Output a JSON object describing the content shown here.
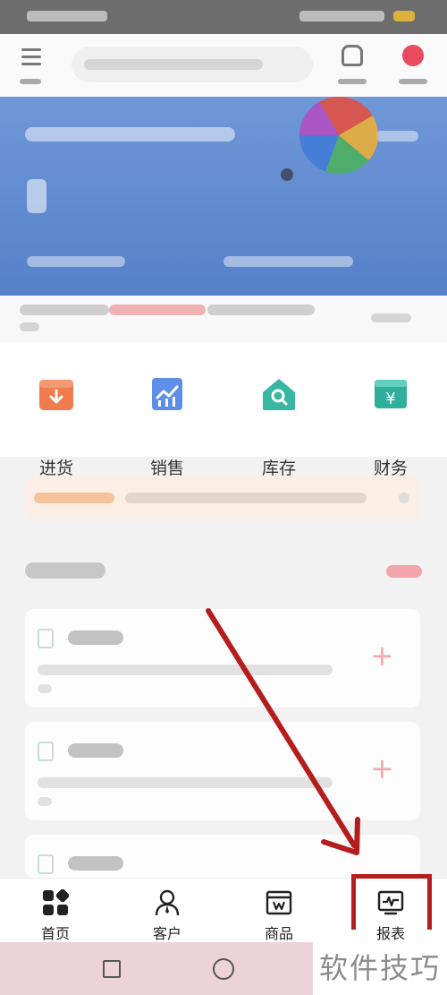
{
  "quick_actions": [
    {
      "label": "进货",
      "icon": "inbound-box-icon",
      "color": "#f07b4c"
    },
    {
      "label": "销售",
      "icon": "sales-chart-icon",
      "color": "#5d8fe6"
    },
    {
      "label": "库存",
      "icon": "inventory-house-icon",
      "color": "#3ab7a3"
    },
    {
      "label": "财务",
      "icon": "finance-yen-icon",
      "color": "#2fae9c"
    }
  ],
  "tabbar": {
    "items": [
      {
        "label": "首页",
        "icon": "home-grid-icon"
      },
      {
        "label": "客户",
        "icon": "customer-person-icon"
      },
      {
        "label": "商品",
        "icon": "goods-box-icon"
      },
      {
        "label": "报表",
        "icon": "report-pulse-icon"
      }
    ]
  },
  "colors": {
    "banner": "#5f8ad0",
    "highlight": "#b51d1d",
    "accent_red": "#e84a5f"
  },
  "watermark": "软件技巧"
}
